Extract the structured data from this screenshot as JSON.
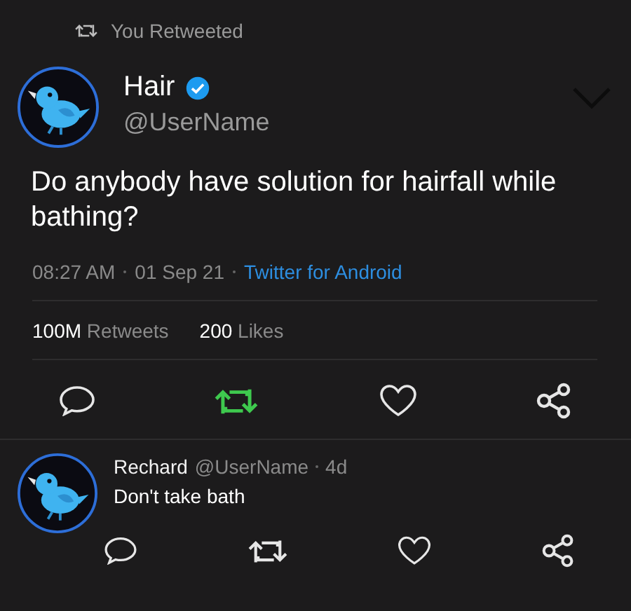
{
  "retweet_banner": {
    "text": "You Retweeted"
  },
  "tweet": {
    "name": "Hair",
    "verified": true,
    "handle": "@UserName",
    "text": "Do anybody have solution for hairfall while bathing?",
    "time": "08:27 AM",
    "date": "01 Sep 21",
    "source": "Twitter for Android",
    "retweets": {
      "count": "100M",
      "label": "Retweets"
    },
    "likes": {
      "count": "200",
      "label": "Likes"
    },
    "actions": [
      {
        "kind": "reply",
        "active": false
      },
      {
        "kind": "retweet",
        "active": true
      },
      {
        "kind": "like",
        "active": false
      },
      {
        "kind": "share",
        "active": false
      }
    ]
  },
  "reply": {
    "name": "Rechard",
    "handle": "@UserName",
    "age": "4d",
    "text": "Don't take bath",
    "actions": [
      {
        "kind": "reply",
        "active": false
      },
      {
        "kind": "retweet",
        "active": false
      },
      {
        "kind": "like",
        "active": false
      },
      {
        "kind": "share",
        "active": false
      }
    ]
  }
}
